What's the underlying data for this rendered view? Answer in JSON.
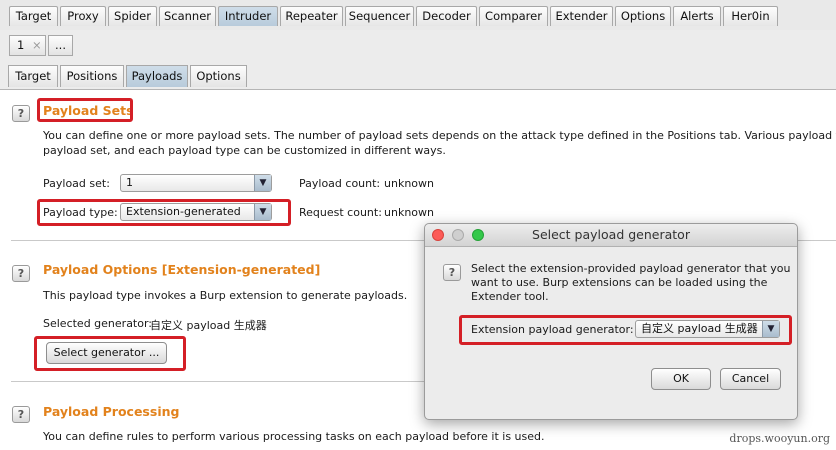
{
  "main_tabs": [
    "Target",
    "Proxy",
    "Spider",
    "Scanner",
    "Intruder",
    "Repeater",
    "Sequencer",
    "Decoder",
    "Comparer",
    "Extender",
    "Options",
    "Alerts",
    "Her0in"
  ],
  "selected_main_tab": "Intruder",
  "session_tabs": {
    "active": "1",
    "close": "×",
    "more": "..."
  },
  "sub_tabs": [
    "Target",
    "Positions",
    "Payloads",
    "Options"
  ],
  "selected_sub_tab": "Payloads",
  "payload_sets": {
    "title": "Payload Sets",
    "description_line1": "You can define one or more payload sets. The number of payload sets depends on the attack type defined in the Positions tab. Various payload types",
    "description_line2": "payload set, and each payload type can be customized in different ways.",
    "set_label": "Payload set:",
    "set_value": "1",
    "count_label": "Payload count:",
    "count_value": "unknown",
    "type_label": "Payload type:",
    "type_value": "Extension-generated",
    "request_label": "Request count:",
    "request_value": "unknown"
  },
  "payload_options": {
    "title": "Payload Options [Extension-generated]",
    "description": "This payload type invokes a Burp extension to generate payloads.",
    "selected_label": "Selected generator:",
    "selected_value": "自定义 payload 生成器",
    "select_button": "Select generator ..."
  },
  "payload_processing": {
    "title": "Payload Processing",
    "description": "You can define rules to perform various processing tasks on each payload before it is used."
  },
  "dialog": {
    "title": "Select payload generator",
    "text_line1": "Select the extension-provided payload generator that you",
    "text_line2": "want to use. Burp extensions can be loaded using the",
    "text_line3": "Extender tool.",
    "generator_label": "Extension payload generator:",
    "generator_value": "自定义 payload 生成器",
    "ok": "OK",
    "cancel": "Cancel"
  },
  "help_icon_glyph": "?",
  "dropdown_arrow_glyph": "▼",
  "watermark": "drops.wooyun.org",
  "colors": {
    "section_title": "#e2821c",
    "highlight": "#d41f26",
    "selected_tab": "#bccddc"
  }
}
